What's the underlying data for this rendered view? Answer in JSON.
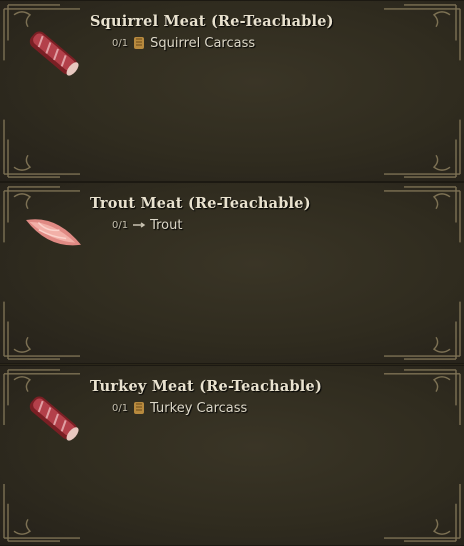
{
  "recipes": [
    {
      "title": "Squirrel Meat (Re-Teachable)",
      "count": "0/1",
      "material_icon": "carcass-icon",
      "material": "Squirrel Carcass",
      "thumbnail": "raw-meat-icon"
    },
    {
      "title": "Trout Meat (Re-Teachable)",
      "count": "0/1",
      "material_icon": "fish-icon",
      "material": "Trout",
      "thumbnail": "fish-fillet-icon"
    },
    {
      "title": "Turkey Meat (Re-Teachable)",
      "count": "0/1",
      "material_icon": "carcass-icon",
      "material": "Turkey Carcass",
      "thumbnail": "raw-meat-icon"
    }
  ],
  "colors": {
    "panel": "#302c1f",
    "title": "#e9e2cf",
    "ornament": "#8c7f5e"
  }
}
